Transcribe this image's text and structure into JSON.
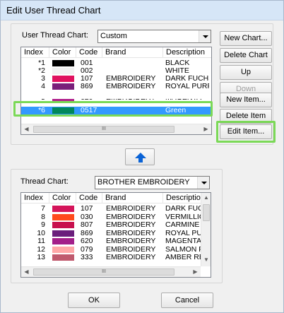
{
  "window": {
    "title": "Edit User Thread Chart"
  },
  "user_chart": {
    "label": "User Thread Chart:",
    "selected": "Custom",
    "columns": [
      "Index",
      "Color",
      "Code",
      "Brand",
      "Description"
    ],
    "rows": [
      {
        "index": "*1",
        "color": "#000000",
        "code": "001",
        "brand": "",
        "description": "BLACK"
      },
      {
        "index": "*2",
        "color": "#f2f2f2",
        "code": "002",
        "brand": "",
        "description": "WHITE"
      },
      {
        "index": "3",
        "color": "#e0115f",
        "code": "107",
        "brand": "EMBROIDERY",
        "description": "DARK FUCHSIA"
      },
      {
        "index": "4",
        "color": "#7a1f7a",
        "code": "869",
        "brand": "EMBROIDERY",
        "description": "ROYAL PURPLE"
      },
      {
        "index": "5",
        "color": "#b0208c",
        "code": "620",
        "brand": "EMBROIDERY",
        "description": "MAGENTA"
      },
      {
        "index": "*6",
        "color": "#00875a",
        "code": "0517",
        "brand": "",
        "description": "Green"
      }
    ],
    "selected_row": 5
  },
  "side_buttons": {
    "new_chart": "New Chart...",
    "delete_chart": "Delete Chart",
    "up": "Up",
    "down": "Down",
    "new_item": "New Item...",
    "delete_item": "Delete Item",
    "edit_item": "Edit Item..."
  },
  "thread_chart": {
    "label": "Thread Chart:",
    "selected": "BROTHER EMBROIDERY",
    "columns": [
      "Index",
      "Color",
      "Code",
      "Brand",
      "Description"
    ],
    "rows": [
      {
        "index": "7",
        "color": "#d4145a",
        "code": "107",
        "brand": "EMBROIDERY",
        "description": "DARK FUCHSIA"
      },
      {
        "index": "8",
        "color": "#ff4a1c",
        "code": "030",
        "brand": "EMBROIDERY",
        "description": "VERMILLION"
      },
      {
        "index": "9",
        "color": "#c8104e",
        "code": "807",
        "brand": "EMBROIDERY",
        "description": "CARMINE"
      },
      {
        "index": "10",
        "color": "#6b1f7c",
        "code": "869",
        "brand": "EMBROIDERY",
        "description": "ROYAL PURPLE"
      },
      {
        "index": "11",
        "color": "#a31f8a",
        "code": "620",
        "brand": "EMBROIDERY",
        "description": "MAGENTA"
      },
      {
        "index": "12",
        "color": "#ffa8a8",
        "code": "079",
        "brand": "EMBROIDERY",
        "description": "SALMON PINK"
      },
      {
        "index": "13",
        "color": "#c05a6e",
        "code": "333",
        "brand": "EMBROIDERY",
        "description": "AMBER RED"
      }
    ]
  },
  "scroll_thumb_glyph": "III",
  "footer": {
    "ok": "OK",
    "cancel": "Cancel"
  },
  "highlight_color": "#7bd957",
  "selection_color": "#3399ff",
  "icons": {
    "transfer": "up-arrow-icon"
  }
}
